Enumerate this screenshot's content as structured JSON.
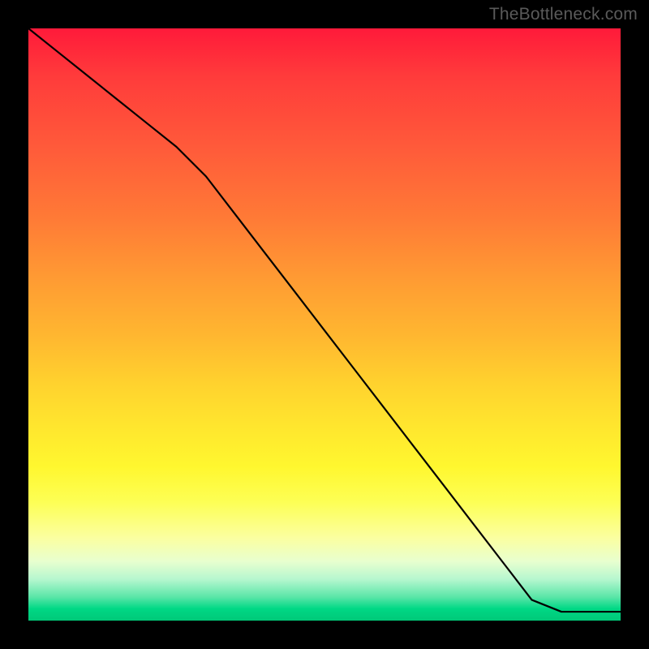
{
  "attribution": "TheBottleneck.com",
  "colors": {
    "curve": "#000000",
    "marker": "#d46a6a",
    "bg_top": "#ff1a3a",
    "bg_bottom": "#00c878"
  },
  "chart_data": {
    "type": "line",
    "title": "",
    "xlabel": "",
    "ylabel": "",
    "xlim": [
      0,
      100
    ],
    "ylim": [
      0,
      100
    ],
    "grid": false,
    "legend": false,
    "series": [
      {
        "name": "curve",
        "x": [
          0,
          5,
          10,
          15,
          20,
          25,
          30,
          35,
          40,
          45,
          50,
          55,
          60,
          65,
          70,
          75,
          80,
          85,
          90,
          95,
          100
        ],
        "y": [
          100,
          96,
          92,
          88,
          84,
          80,
          75,
          68.5,
          62,
          55.5,
          49,
          42.5,
          36,
          29.5,
          23,
          16.5,
          10,
          3.5,
          1.5,
          1.5,
          1.5
        ]
      }
    ],
    "highlighted_segments": [
      {
        "x_start": 55,
        "x_end": 67,
        "thick": true
      },
      {
        "x_start": 68,
        "x_end": 70,
        "thick": false
      },
      {
        "x_start": 71,
        "x_end": 76,
        "thick": true
      },
      {
        "x_start": 78,
        "x_end": 79,
        "thick": false
      }
    ],
    "background_gradient": {
      "direction": "vertical",
      "stops": [
        {
          "pos": 0.0,
          "color": "#ff1a3a"
        },
        {
          "pos": 0.4,
          "color": "#ff9a33"
        },
        {
          "pos": 0.7,
          "color": "#fff72f"
        },
        {
          "pos": 0.88,
          "color": "#fbffa0"
        },
        {
          "pos": 1.0,
          "color": "#00c878"
        }
      ]
    }
  }
}
